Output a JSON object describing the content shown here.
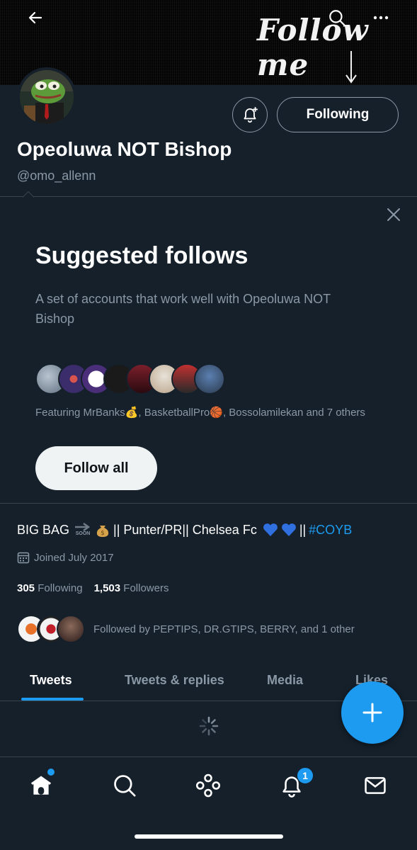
{
  "banner": {
    "overlay_text": "Follow me"
  },
  "profile": {
    "name": "Opeoluwa NOT Bishop",
    "handle": "@omo_allenn",
    "following_button": "Following",
    "bio_prefix": "BIG BAG",
    "bio_soon": "SOON",
    "bio_main": "|| Punter/PR|| Chelsea Fc",
    "bio_separator": "||",
    "bio_hashtag": "#COYB",
    "joined": "Joined July 2017",
    "following_count": "305",
    "following_label": "Following",
    "followers_count": "1,503",
    "followers_label": "Followers",
    "followed_by": "Followed by PEPTIPS, DR.GTIPS, BERRY, and 1 other"
  },
  "suggested": {
    "title": "Suggested follows",
    "description": "A set of accounts that work well with Opeoluwa NOT Bishop",
    "featuring": "Featuring MrBanks💰, BasketballPro🏀, Bossolamilekan and 7 others",
    "follow_all": "Follow all"
  },
  "tabs": [
    {
      "label": "Tweets"
    },
    {
      "label": "Tweets & replies"
    },
    {
      "label": "Media"
    },
    {
      "label": "Likes"
    }
  ],
  "nav": {
    "notifications_badge": "1"
  },
  "colors": {
    "background": "#15202b",
    "accent": "#1d9bf0",
    "muted": "#8b98a5"
  },
  "icons": [
    "back-arrow-icon",
    "search-icon",
    "more-icon",
    "bell-plus-icon",
    "close-icon",
    "calendar-icon",
    "plus-icon",
    "home-icon",
    "explore-icon",
    "spaces-icon",
    "bell-icon",
    "mail-icon"
  ]
}
